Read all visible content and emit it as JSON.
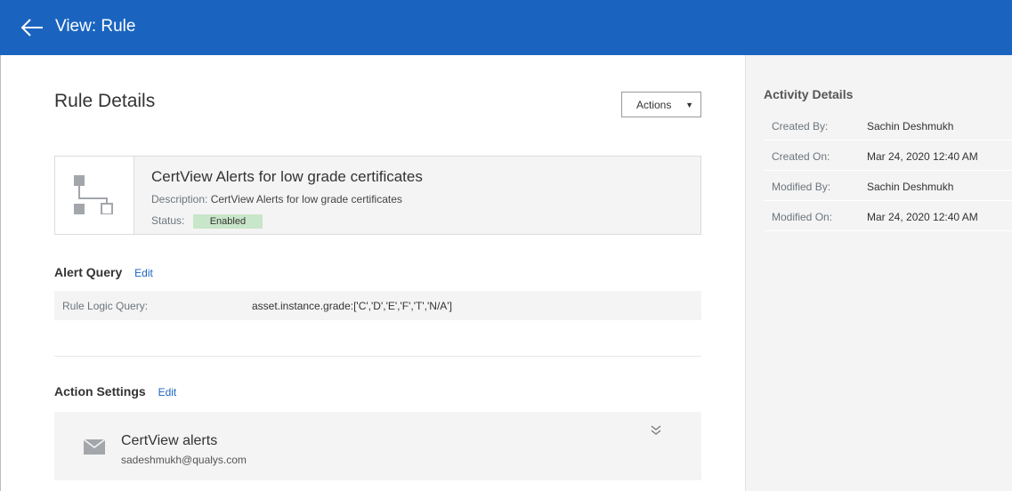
{
  "header": {
    "title": "View: Rule",
    "back_icon": "arrow-left-icon",
    "background": "#1a64c0"
  },
  "main": {
    "page_title": "Rule Details",
    "actions_label": "Actions",
    "rule": {
      "name": "CertView Alerts for low grade certificates",
      "description_label": "Description:",
      "description": "CertView Alerts for low grade certificates",
      "status_label": "Status:",
      "status": "Enabled",
      "icon": "hierarchy-icon"
    },
    "alert_query": {
      "heading": "Alert Query",
      "edit_label": "Edit",
      "query_label": "Rule Logic Query:",
      "query_value": "asset.instance.grade:['C','D','E','F','T','N/A']"
    },
    "action_settings": {
      "heading": "Action Settings",
      "edit_label": "Edit",
      "action_title": "CertView alerts",
      "action_email": "sadeshmukh@qualys.com",
      "icons": [
        "mail-icon",
        "double-chevron-down-icon"
      ]
    }
  },
  "activity": {
    "title": "Activity Details",
    "rows": [
      {
        "label": "Created By:",
        "value": "Sachin Deshmukh"
      },
      {
        "label": "Created On:",
        "value": "Mar 24, 2020 12:40 AM"
      },
      {
        "label": "Modified By:",
        "value": "Sachin Deshmukh"
      },
      {
        "label": "Modified On:",
        "value": "Mar 24, 2020 12:40 AM"
      }
    ]
  },
  "colors": {
    "brand": "#1a64c0",
    "status_enabled": "#c8e6c9",
    "panel": "#f4f4f4"
  }
}
